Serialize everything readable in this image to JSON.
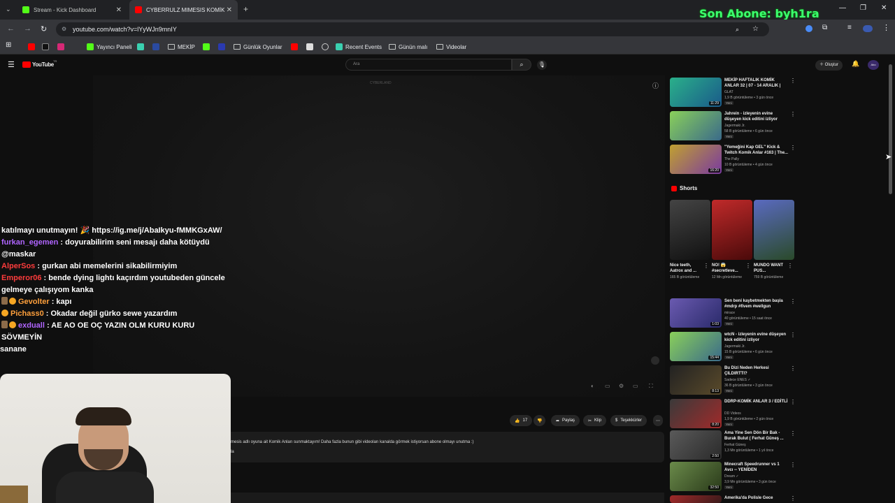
{
  "browser": {
    "tabs": [
      {
        "title": "Stream - Kick Dashboard",
        "active": false
      },
      {
        "title": "CYBERRULZ MIMESIS KOMİK A",
        "active": true
      }
    ],
    "url": "youtube.com/watch?v=lYyWJn9mnIY",
    "bookmarks": [
      "Yayıncı Paneli",
      "MEKİP",
      "Günlük Oyunlar",
      "Recent Events",
      "Günün malı",
      "Videolar"
    ]
  },
  "overlay": {
    "subscriber_banner": "Son Abone: byh1ra"
  },
  "youtube": {
    "logo_text": "YouTube",
    "logo_region": "TR",
    "search_placeholder": "Ara",
    "create_label": "Oluştur",
    "account_label": "Abo",
    "player_watermark": "CYBERLAND",
    "actions": {
      "like_count": "17",
      "share": "Paylaş",
      "clip": "Klip",
      "thanks": "Teşekkürler"
    },
    "description_line": "mesis adlı oyuna ait Komik Anları sunmaktayım! Daha fazla bunun gibi videoları kanalda görmek istiyorsan abone olmayı unutma :)",
    "description_more": "la"
  },
  "chat": [
    {
      "user": "",
      "text": "katılmayı unutmayın! 🎉 https://ig.me/j/AbaIkyu-fMMKGxAW/",
      "color": "#fff"
    },
    {
      "user": "furkan_egemen",
      "text": ": doyurabilirim seni mesajı daha kötüydü @maskar",
      "color": "purple"
    },
    {
      "user": "AlperSos",
      "text": ": gurkan abi memelerini sikabilirmiyim",
      "color": "red"
    },
    {
      "user": "Emperor06",
      "text": ": bende dying lightı kaçırdım youtubeden güncele gelmeye çalışıyom kanka",
      "color": "red"
    },
    {
      "user": "Gevolter",
      "text": ": kapı",
      "color": "orange"
    },
    {
      "user": "Pichass0",
      "text": ": Okadar değil gürko sewe yazardım",
      "color": "orange"
    },
    {
      "user": "exduall",
      "text": ": AE AO OE OÇ YAZIN OLM KURU KURU SÖVMEYİN",
      "color": "purple"
    },
    {
      "user": "",
      "text": "sanane",
      "color": "#fff"
    }
  ],
  "sidebar": {
    "videos_top": [
      {
        "title": "MEKİP HAFTALIK KOMİK ANLAR 32 | 07 - 14 ARALIK |",
        "channel": "GLAT",
        "meta": "1,9 B görüntüleme • 3 gün önce",
        "badge": "Yeni",
        "duration": "11:29",
        "thumb_color": "#3a8f7a"
      },
      {
        "title": "Jahrein - izleyenin evine düşeyen kick editini izliyor",
        "channel": "Jagermaki Jr.",
        "meta": "58 B görüntüleme • 6 gün önce",
        "badge": "Yeni",
        "duration": "",
        "thumb_color": "#6aa04a"
      },
      {
        "title": "\"Yemeğini Kap GEL\" Kick & Twitch Komik Anlar #163 | The...",
        "channel": "The Pally",
        "meta": "10 B görüntüleme • 4 gün önce",
        "badge": "Yeni",
        "duration": "16:20",
        "thumb_color": "#8a4aa0"
      }
    ],
    "shorts_label": "Shorts",
    "shorts": [
      {
        "title": "Nice teeth, Aatrox and ...",
        "views": "165 B görüntüleme",
        "thumb_color": "#2a2a2a"
      },
      {
        "title": "NO! 😱 #secretleve...",
        "views": "12 Mn görüntüleme",
        "thumb_color": "#8a1a1a"
      },
      {
        "title": "MUNDO WANT PUS...",
        "views": "759 B görüntüleme",
        "thumb_color": "#3a4a8a"
      }
    ],
    "videos_bottom": [
      {
        "title": "Sen beni kaybetmekten başla #mdrp #fivem #wellgun",
        "channel": "mirace",
        "meta": "40 görüntüleme • 15 saat önce",
        "badge": "Yeni",
        "duration": "1:03",
        "thumb_color": "#5a4a9a"
      },
      {
        "title": "wtcN - izleyenin evine düşeyen kick editini izliyor",
        "channel": "Jagermaki Jr.",
        "meta": "15 B görüntüleme • 6 gün önce",
        "badge": "Yeni",
        "duration": "15:44",
        "thumb_color": "#5aa04a"
      },
      {
        "title": "Bu Dizi Neden Herkesi ÇILDIRTTI?",
        "channel": "Sadece ENES ✓",
        "meta": "36 B görüntüleme • 3 gün önce",
        "badge": "Yeni",
        "duration": "8:13",
        "thumb_color": "#2a2a2a"
      },
      {
        "title": "DDRP-KOMİK ANLAR 3 / EDİTLİ",
        "channel": "DD Videos",
        "meta": "1,9 B görüntüleme • 2 gün önce",
        "badge": "Yeni",
        "duration": "8:20",
        "thumb_color": "#7a2a2a"
      },
      {
        "title": "Ama Yine Sen Dön Bir Bak - Burak Bulut ( Ferhat Güneş ...",
        "channel": "Ferhat Güneş",
        "meta": "1,3 Mn görüntüleme • 1 yıl önce",
        "badge": "",
        "duration": "2:50",
        "thumb_color": "#4a4a4a"
      },
      {
        "title": "Minecraft Speedrunner vs 1 Avcı -- YENİDEN",
        "channel": "Dream ✓",
        "meta": "3,9 Mn görüntüleme • 3 gün önce",
        "badge": "Yeni",
        "duration": "32:50",
        "thumb_color": "#4a7a3a"
      },
      {
        "title": "Amerika'da Polisle Gece",
        "channel": "",
        "meta": "",
        "badge": "",
        "duration": "",
        "thumb_color": "#8a2a2a"
      }
    ]
  }
}
